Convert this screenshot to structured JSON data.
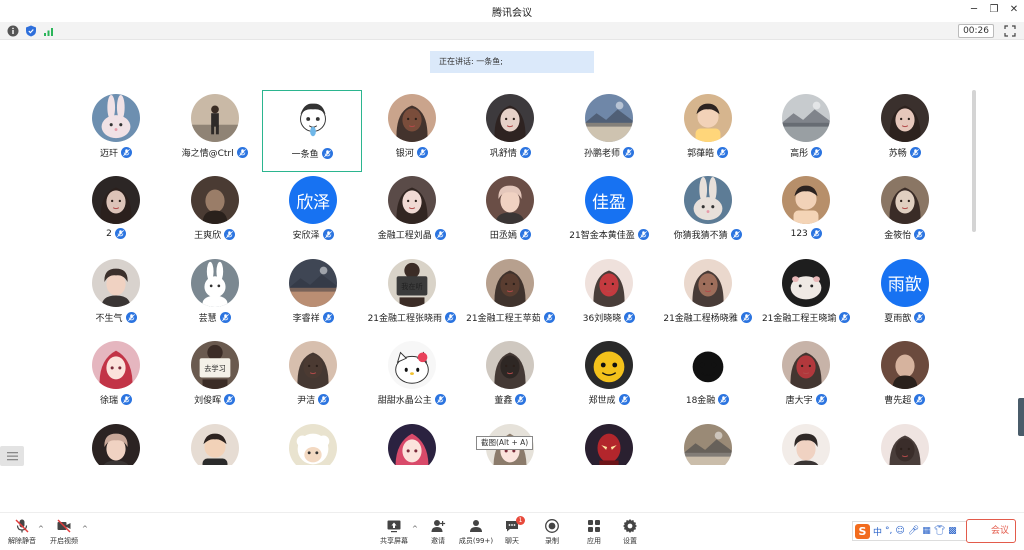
{
  "window": {
    "title": "腾讯会议"
  },
  "status": {
    "timer": "00:26"
  },
  "speaker": {
    "text": "正在讲话: 一条鱼;"
  },
  "tooltip": {
    "text": "截图(Alt + A)"
  },
  "colors": {
    "accent": "#1772f2",
    "active_border": "#2bb58f",
    "speaker_bg": "#dbe9fa",
    "badge": "#e84a3c",
    "leave": "#e35b4b"
  },
  "participants": [
    {
      "name": "迈玕",
      "avatar": "rabbit-photo",
      "bg": "#6d8fb0",
      "fg": "#f1e2e6"
    },
    {
      "name": "海之情@Ctrl",
      "avatar": "person-photo",
      "bg": "#c9b9a6",
      "fg": "#3a3a3a"
    },
    {
      "name": "一条鱼",
      "avatar": "cartoon-boy",
      "bg": "#ffffff",
      "fg": "#333333",
      "active": true
    },
    {
      "name": "银河",
      "avatar": "girl-photo",
      "bg": "#caa48c",
      "fg": "#7a4d3b"
    },
    {
      "name": "巩舒情",
      "avatar": "girl-photo",
      "bg": "#3d3a3d",
      "fg": "#e6d1c8"
    },
    {
      "name": "孙鹏老师",
      "avatar": "landscape-photo",
      "bg": "#6f87a8",
      "fg": "#e6d2b1"
    },
    {
      "name": "郭葎皓",
      "avatar": "child-photo",
      "bg": "#d6b58e",
      "fg": "#ffd67a"
    },
    {
      "name": "高彤",
      "avatar": "landscape-photo",
      "bg": "#c7cbce",
      "fg": "#8d9499"
    },
    {
      "name": "苏畅",
      "avatar": "girl-photo",
      "bg": "#3a302d",
      "fg": "#e6c7bb"
    },
    {
      "name": "2",
      "avatar": "girl-photo",
      "bg": "#2c2625",
      "fg": "#dcc3b8"
    },
    {
      "name": "王爽欣",
      "avatar": "dark-photo",
      "bg": "#4a3b33",
      "fg": "#9a7d68"
    },
    {
      "name": "安欣泽",
      "text": "欣泽"
    },
    {
      "name": "金融工程刘晶",
      "avatar": "girl-photo",
      "bg": "#5a4b48",
      "fg": "#f0d9d3"
    },
    {
      "name": "田丞嫣",
      "avatar": "boy-photo",
      "bg": "#6a4e46",
      "fg": "#e4c7bb"
    },
    {
      "name": "21智金本黄佳盈",
      "text": "佳盈"
    },
    {
      "name": "你猜我猜不猜",
      "avatar": "rabbit-photo",
      "bg": "#5d7c96",
      "fg": "#e8e0da"
    },
    {
      "name": "123",
      "avatar": "child-photo",
      "bg": "#b78f6a",
      "fg": "#f4d4b6"
    },
    {
      "name": "金筱怡",
      "avatar": "girl-photo",
      "bg": "#8a7664",
      "fg": "#e0cfc0"
    },
    {
      "name": "不生气",
      "avatar": "boy-photo",
      "bg": "#d8d2cd",
      "fg": "#3b302c"
    },
    {
      "name": "芸慧",
      "avatar": "rabbit-figure",
      "bg": "#7b8891",
      "fg": "#ffffff"
    },
    {
      "name": "李睿祥",
      "avatar": "landscape-photo",
      "bg": "#3f4654",
      "fg": "#d9a07a"
    },
    {
      "name": "21金融工程张晓雨",
      "avatar": "sign-photo",
      "bg": "#d9d3c8",
      "fg": "#3b3b3b",
      "sign": "我在听"
    },
    {
      "name": "21金融工程王苹茹",
      "avatar": "girl-photo",
      "bg": "#b7a08e",
      "fg": "#5a3d30"
    },
    {
      "name": "36刘晓晓",
      "avatar": "girl-photo",
      "bg": "#efe1dc",
      "fg": "#c43a3f"
    },
    {
      "name": "21金融工程杨晓雅",
      "avatar": "girl-photo",
      "bg": "#ead8cd",
      "fg": "#9e6e5b"
    },
    {
      "name": "21金融工程王晓瑜",
      "avatar": "hamster-photo",
      "bg": "#1e1e1e",
      "fg": "#efe9e4"
    },
    {
      "name": "夏雨歆",
      "text": "雨歆"
    },
    {
      "name": "徐瑞",
      "avatar": "anime-girl",
      "bg": "#e5b6bf",
      "fg": "#c23447"
    },
    {
      "name": "刘俊晖",
      "avatar": "sign-photo",
      "bg": "#6a5a4f",
      "fg": "#f4f1e8",
      "sign": "去学习"
    },
    {
      "name": "尹洁",
      "avatar": "girl-photo",
      "bg": "#d7bfae",
      "fg": "#4b3a32"
    },
    {
      "name": "甜甜水晶公主",
      "avatar": "hello-kitty",
      "bg": "#f7f7f7",
      "fg": "#e9415a"
    },
    {
      "name": "董鑫",
      "avatar": "girl-photo",
      "bg": "#cfc8c0",
      "fg": "#2e2724"
    },
    {
      "name": "郑世成",
      "avatar": "cartoon-face",
      "bg": "#2a2a2a",
      "fg": "#f4c21b"
    },
    {
      "name": "18金融",
      "avatar": "cartoon-face",
      "bg": "#ffffff",
      "fg": "#111111"
    },
    {
      "name": "唐大宇",
      "avatar": "girl-photo",
      "bg": "#c7b3a8",
      "fg": "#b2383c"
    },
    {
      "name": "曹先超",
      "avatar": "dark-photo",
      "bg": "#6b4a3d",
      "fg": "#d6b39e"
    },
    {
      "name": "",
      "avatar": "boy-photo",
      "bg": "#2b2322",
      "fg": "#c9a899"
    },
    {
      "name": "",
      "avatar": "child-photo",
      "bg": "#e6dcd3",
      "fg": "#2b2b2b"
    },
    {
      "name": "",
      "avatar": "sheep-cartoon",
      "bg": "#e9e3cf",
      "fg": "#ffffff"
    },
    {
      "name": "",
      "avatar": "anime-girl",
      "bg": "#2b2240",
      "fg": "#d94a6a"
    },
    {
      "name": "",
      "avatar": "anime-girl",
      "bg": "#e6e2da",
      "fg": "#8b7b6b"
    },
    {
      "name": "",
      "avatar": "superhero-photo",
      "bg": "#2a2030",
      "fg": "#b3262c"
    },
    {
      "name": "",
      "avatar": "landscape-photo",
      "bg": "#9a8a76",
      "fg": "#d6c9b8"
    },
    {
      "name": "",
      "avatar": "boy-photo",
      "bg": "#f2ece8",
      "fg": "#2f2826"
    },
    {
      "name": "",
      "avatar": "girl-photo",
      "bg": "#efe4e1",
      "fg": "#3a2d2a"
    }
  ],
  "toolbar": {
    "mute": "解除静音",
    "video": "开启视频",
    "share": "共享屏幕",
    "invite": "邀请",
    "members": "成员(99+)",
    "chat": "聊天",
    "chat_badge": "1",
    "record": "录制",
    "apps": "应用",
    "settings": "设置",
    "leave": "会议"
  },
  "ime": {
    "lang": "中"
  }
}
